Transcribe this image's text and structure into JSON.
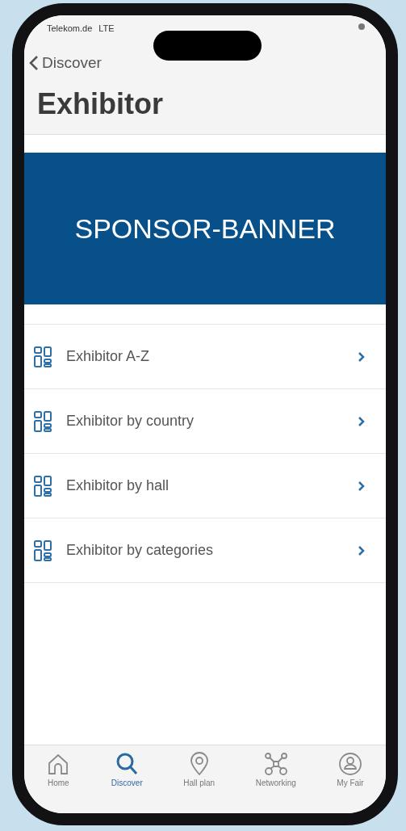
{
  "status_bar": {
    "carrier": "Telekom.de",
    "network": "LTE"
  },
  "nav": {
    "back_label": "Discover"
  },
  "title": "Exhibitor",
  "banner": {
    "text": "SPONSOR-BANNER"
  },
  "menu_items": [
    {
      "label": "Exhibitor A-Z"
    },
    {
      "label": "Exhibitor by country"
    },
    {
      "label": "Exhibitor by hall"
    },
    {
      "label": "Exhibitor by categories"
    }
  ],
  "tab_bar": [
    {
      "kind": "home",
      "label": "Home",
      "selected": false
    },
    {
      "kind": "search",
      "label": "Discover",
      "selected": true
    },
    {
      "kind": "pin",
      "label": "Hall plan",
      "selected": false
    },
    {
      "kind": "network",
      "label": "Networking",
      "selected": false
    },
    {
      "kind": "person",
      "label": "My Fair",
      "selected": false
    }
  ]
}
